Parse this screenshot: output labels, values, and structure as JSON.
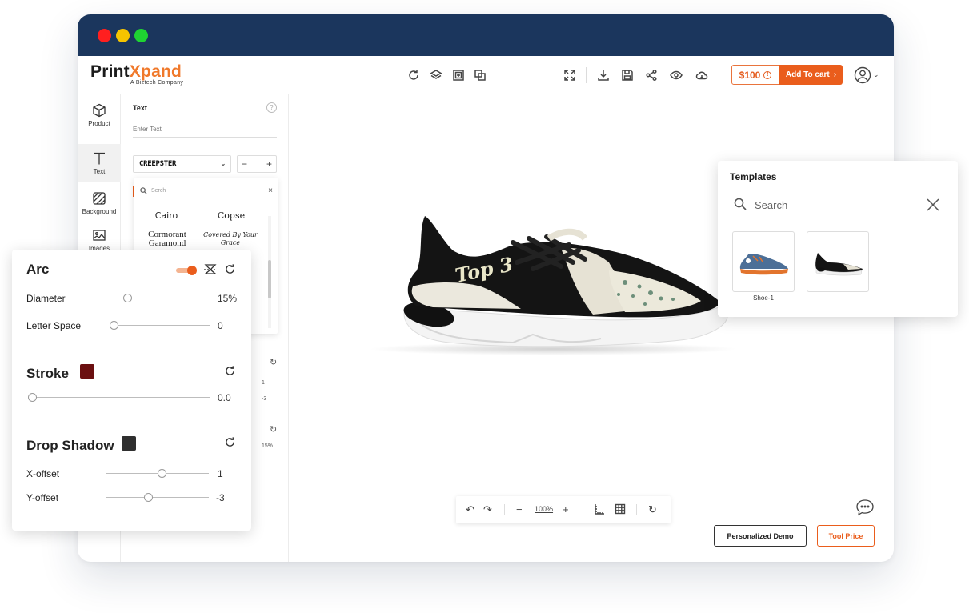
{
  "brand": {
    "name_main": "Print",
    "name_accent": "Xpand",
    "tagline": "A Biztech Company"
  },
  "colors": {
    "titlebar": "#1b365d",
    "accent": "#ea5d1c",
    "stroke_swatch": "#6b0f10",
    "shadow_swatch": "#2f2f2f"
  },
  "toolbar": {
    "icons": [
      "refresh-icon",
      "layers-icon",
      "add-frame-icon",
      "duplicate-icon",
      "fullscreen-icon",
      "download-icon",
      "save-icon",
      "share-icon",
      "preview-icon",
      "cloud-icon"
    ],
    "price": "$100",
    "price_info": "!",
    "add_to_cart": "Add To cart"
  },
  "sidebar": {
    "items": [
      {
        "label": "Product",
        "icon": "cube-icon"
      },
      {
        "label": "Text",
        "icon": "text-icon"
      },
      {
        "label": "Background",
        "icon": "background-icon"
      },
      {
        "label": "Images",
        "icon": "image-icon"
      }
    ]
  },
  "text_panel": {
    "title": "Text",
    "help": "?",
    "input_placeholder": "Enter Text",
    "font_selected": "CREEPSTER",
    "stepper_minus": "−",
    "stepper_plus": "+",
    "font_search_placeholder": "Serch",
    "fonts": [
      "Cairo",
      "Copse",
      "Cormorant Garamond",
      "Covered By Your Grace"
    ],
    "mini_values": [
      "1",
      "-3",
      "15%"
    ]
  },
  "canvas": {
    "shoe_text": "Top 3",
    "zoom": "100%",
    "personalized_demo": "Personalized Demo",
    "tool_price": "Tool Price"
  },
  "templates": {
    "title": "Templates",
    "search_placeholder": "Search",
    "items": [
      {
        "label": "Shoe-1"
      },
      {
        "label": ""
      }
    ]
  },
  "arc_card": {
    "arc": {
      "title": "Arc",
      "enabled": true,
      "diameter_label": "Diameter",
      "diameter_value": "15%",
      "diameter_level": 0.15,
      "letter_space_label": "Letter Space",
      "letter_space_value": "0",
      "letter_space_level": 0
    },
    "stroke": {
      "title": "Stroke",
      "value": "0.0",
      "level": 0
    },
    "drop_shadow": {
      "title": "Drop Shadow",
      "x_offset_label": "X-offset",
      "x_offset_value": "1",
      "x_offset_level": 0.55,
      "y_offset_label": "Y-offset",
      "y_offset_value": "-3",
      "y_offset_level": 0.4
    }
  }
}
